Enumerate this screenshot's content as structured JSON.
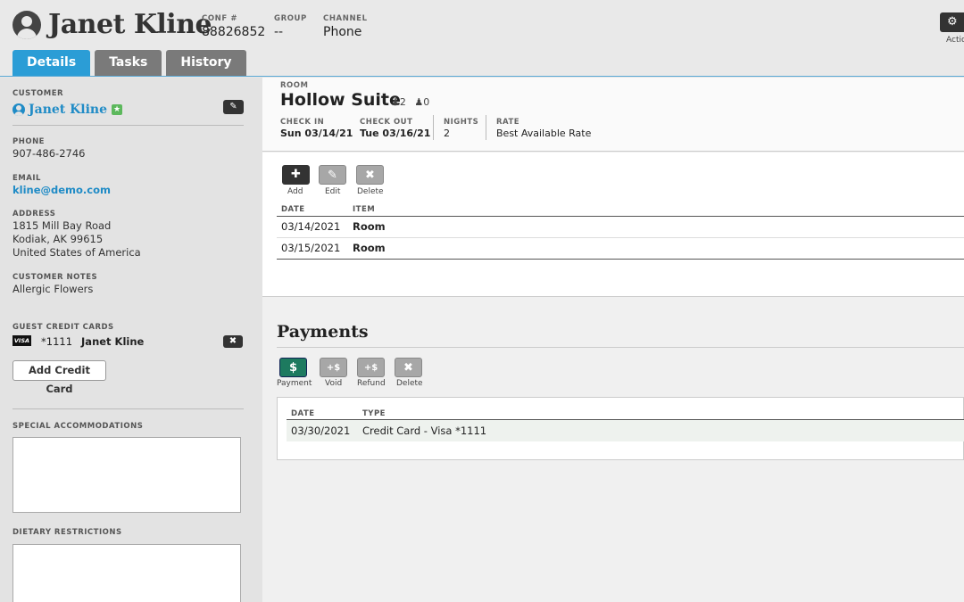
{
  "header": {
    "guest_name": "Janet Kline",
    "conf_label": "CONF #",
    "conf_value": "88826852",
    "group_label": "GROUP",
    "group_value": "--",
    "channel_label": "CHANNEL",
    "channel_value": "Phone",
    "actions_label": "Actio",
    "tabs": [
      {
        "label": "Details",
        "active": true
      },
      {
        "label": "Tasks",
        "active": false
      },
      {
        "label": "History",
        "active": false
      }
    ]
  },
  "sidebar": {
    "customer_label": "CUSTOMER",
    "customer_name": "Janet Kline",
    "phone_label": "PHONE",
    "phone": "907-486-2746",
    "email_label": "EMAIL",
    "email": "kline@demo.com",
    "address_label": "ADDRESS",
    "address_line1": "1815 Mill Bay Road",
    "address_line2": "Kodiak, AK 99615",
    "address_line3": "United States of America",
    "notes_label": "CUSTOMER NOTES",
    "notes": "Allergic Flowers",
    "cards_label": "GUEST CREDIT CARDS",
    "card_brand": "VISA",
    "card_number": "*1111",
    "card_holder": "Janet Kline",
    "add_card_label": "Add Credit Card",
    "special_label": "SPECIAL ACCOMMODATIONS",
    "dietary_label": "DIETARY RESTRICTIONS"
  },
  "room": {
    "room_label": "ROOM",
    "room_name": "Hollow Suite",
    "adults": "2",
    "children": "0",
    "checkin_label": "CHECK IN",
    "checkin": "Sun 03/14/21",
    "checkout_label": "CHECK OUT",
    "checkout": "Tue 03/16/21",
    "nights_label": "NIGHTS",
    "nights": "2",
    "rate_label": "RATE",
    "rate": "Best Available Rate"
  },
  "items": {
    "toolbar": {
      "add": "Add",
      "edit": "Edit",
      "delete": "Delete"
    },
    "col_date": "DATE",
    "col_item": "ITEM",
    "rows": [
      {
        "date": "03/14/2021",
        "item": "Room"
      },
      {
        "date": "03/15/2021",
        "item": "Room"
      }
    ]
  },
  "payments": {
    "title": "Payments",
    "toolbar": {
      "payment": "Payment",
      "void": "Void",
      "refund": "Refund",
      "delete": "Delete"
    },
    "col_date": "DATE",
    "col_type": "TYPE",
    "rows": [
      {
        "date": "03/30/2021",
        "type": "Credit Card - Visa *1111"
      }
    ]
  },
  "colors": {
    "accent_blue": "#2b9dd6",
    "tab_inactive": "#7a7a7a",
    "payment_green": "#1d7a5f",
    "badge_green": "#5cb85c"
  }
}
